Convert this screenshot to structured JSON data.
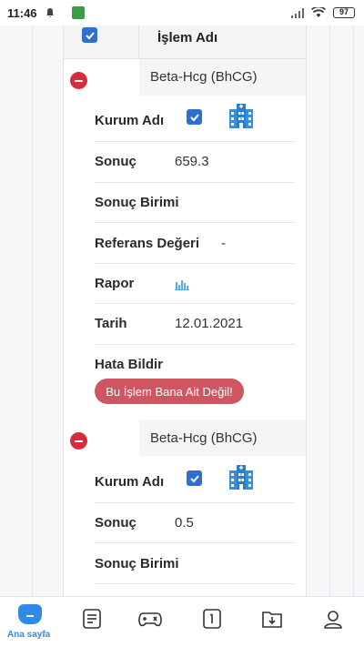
{
  "status_bar": {
    "time": "11:46",
    "battery": "97"
  },
  "header": {
    "title": "İşlem Adı"
  },
  "records": [
    {
      "test_name": "Beta-Hcg (BhCG)",
      "fields": {
        "kurum_label": "Kurum Adı",
        "sonuc_label": "Sonuç",
        "sonuc_value": "659.3",
        "birim_label": "Sonuç Birimi",
        "referans_label": "Referans Değeri",
        "referans_value": "-",
        "rapor_label": "Rapor",
        "tarih_label": "Tarih",
        "tarih_value": "12.01.2021",
        "hata_label": "Hata Bildir",
        "hata_button": "Bu İşlem Bana Ait Değil!"
      }
    },
    {
      "test_name": "Beta-Hcg (BhCG)",
      "fields": {
        "kurum_label": "Kurum Adı",
        "sonuc_label": "Sonuç",
        "sonuc_value": "0.5",
        "birim_label": "Sonuç Birimi"
      }
    }
  ],
  "nav": {
    "home_label": "Ana sayfa"
  },
  "colors": {
    "accent": "#2f8be6",
    "danger": "#d42e3e",
    "button": "#cf5560",
    "checkbox": "#2f6fd1"
  }
}
